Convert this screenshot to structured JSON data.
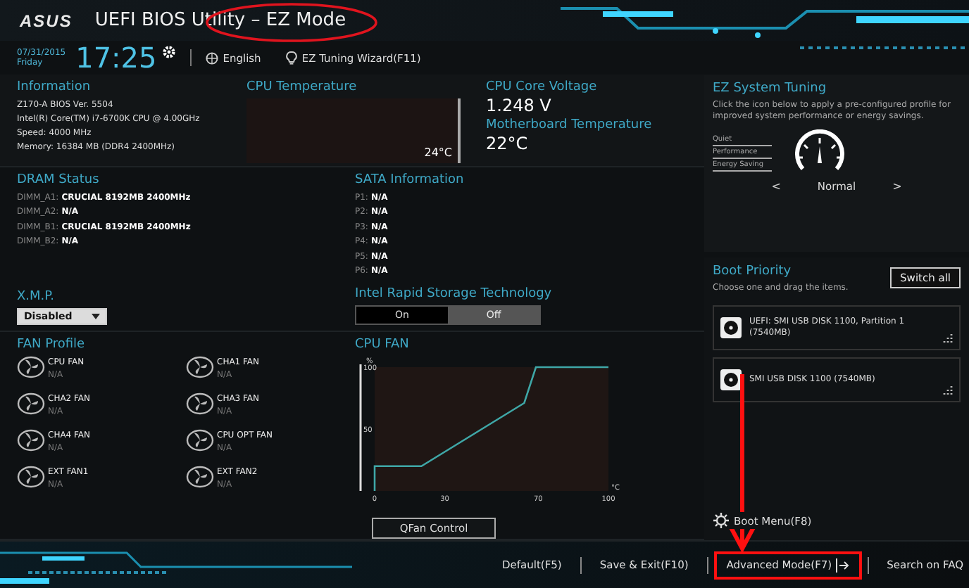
{
  "header": {
    "logo": "ASUS",
    "title": "UEFI BIOS Utility – EZ Mode"
  },
  "topbar": {
    "date": "07/31/2015",
    "day": "Friday",
    "time": "17:25",
    "language": "English",
    "wizard": "EZ Tuning Wizard(F11)"
  },
  "information": {
    "title": "Information",
    "lines": [
      "Z170-A   BIOS Ver. 5504",
      "Intel(R) Core(TM) i7-6700K CPU @ 4.00GHz",
      "Speed: 4000 MHz",
      "Memory: 16384 MB (DDR4 2400MHz)"
    ]
  },
  "cpu_temperature": {
    "title": "CPU Temperature",
    "reading": "24°C"
  },
  "voltage": {
    "title": "CPU Core Voltage",
    "value": "1.248 V",
    "mb_title": "Motherboard Temperature",
    "mb_value": "22°C"
  },
  "dram": {
    "title": "DRAM Status",
    "slots": [
      {
        "label": "DIMM_A1:",
        "value": "CRUCIAL 8192MB 2400MHz"
      },
      {
        "label": "DIMM_A2:",
        "value": "N/A"
      },
      {
        "label": "DIMM_B1:",
        "value": "CRUCIAL 8192MB 2400MHz"
      },
      {
        "label": "DIMM_B2:",
        "value": "N/A"
      }
    ]
  },
  "sata": {
    "title": "SATA Information",
    "ports": [
      {
        "label": "P1:",
        "value": "N/A"
      },
      {
        "label": "P2:",
        "value": "N/A"
      },
      {
        "label": "P3:",
        "value": "N/A"
      },
      {
        "label": "P4:",
        "value": "N/A"
      },
      {
        "label": "P5:",
        "value": "N/A"
      },
      {
        "label": "P6:",
        "value": "N/A"
      }
    ]
  },
  "xmp": {
    "title": "X.M.P.",
    "value": "Disabled"
  },
  "irst": {
    "title": "Intel Rapid Storage Technology",
    "options": [
      {
        "label": "On",
        "selected": false
      },
      {
        "label": "Off",
        "selected": true
      }
    ]
  },
  "fan_profile": {
    "title": "FAN Profile",
    "fans": [
      {
        "name": "CPU FAN",
        "reading": "N/A"
      },
      {
        "name": "CHA1 FAN",
        "reading": "N/A"
      },
      {
        "name": "CHA2 FAN",
        "reading": "N/A"
      },
      {
        "name": "CHA3 FAN",
        "reading": "N/A"
      },
      {
        "name": "CHA4 FAN",
        "reading": "N/A"
      },
      {
        "name": "CPU OPT FAN",
        "reading": "N/A"
      },
      {
        "name": "EXT FAN1",
        "reading": "N/A"
      },
      {
        "name": "EXT FAN2",
        "reading": "N/A"
      }
    ]
  },
  "cpu_fan": {
    "title": "CPU FAN",
    "button": "QFan Control",
    "chart_data": {
      "type": "line",
      "xlabel": "°C",
      "ylabel": "%",
      "xlim": [
        0,
        100
      ],
      "ylim": [
        0,
        100
      ],
      "xticks": [
        0,
        30,
        70,
        100
      ],
      "yticks": [
        50,
        100
      ],
      "x": [
        0,
        0,
        20,
        64,
        69,
        100
      ],
      "series": [
        {
          "color": "#3fa7a7",
          "values": [
            0,
            20,
            20,
            71,
            100,
            100
          ]
        }
      ]
    }
  },
  "ez_tuning": {
    "title": "EZ System Tuning",
    "description": "Click the icon below to apply a pre-configured profile for improved system performance or energy savings.",
    "modes": [
      {
        "label": "Quiet"
      },
      {
        "label": "Performance"
      },
      {
        "label": "Energy Saving"
      }
    ],
    "prev": "<",
    "current": "Normal",
    "next": ">"
  },
  "boot": {
    "title": "Boot Priority",
    "hint": "Choose one and drag the items.",
    "switch_all": "Switch all",
    "devices": [
      {
        "label": "UEFI: SMI USB DISK 1100, Partition 1 (7540MB)"
      },
      {
        "label": "SMI USB DISK 1100  (7540MB)"
      }
    ],
    "boot_menu": "Boot Menu(F8)"
  },
  "footer": [
    {
      "label": "Default(F5)"
    },
    {
      "label": "Save & Exit(F10)"
    },
    {
      "label": "Advanced Mode(F7)"
    },
    {
      "label": "Search on FAQ"
    }
  ],
  "annotations": [
    {
      "kind": "ellipse"
    },
    {
      "kind": "arrow"
    },
    {
      "kind": "rectangle"
    }
  ]
}
